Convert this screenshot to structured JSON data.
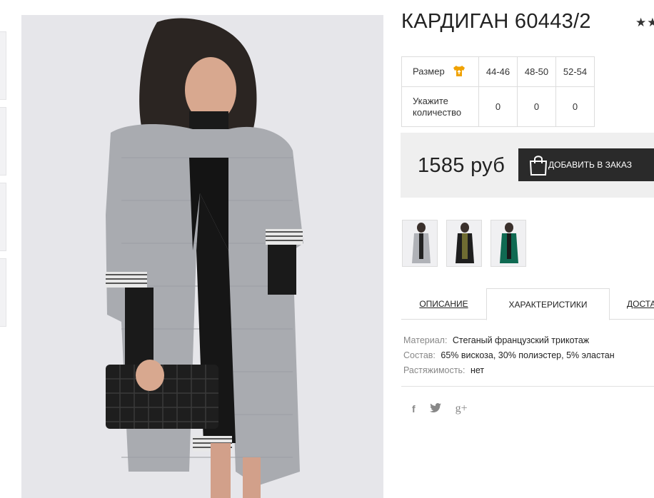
{
  "product": {
    "title": "КАРДИГАН 60443/2",
    "rating_stars": "★★"
  },
  "size_table": {
    "size_label": "Размер",
    "sizes": [
      "44-46",
      "48-50",
      "52-54"
    ],
    "quantity_label_line1": "Укажите",
    "quantity_label_line2": "количество",
    "quantities": [
      "0",
      "0",
      "0"
    ]
  },
  "price": {
    "amount": "1585 руб",
    "add_to_cart_label": "ДОБАВИТЬ В ЗАКАЗ"
  },
  "tabs": [
    {
      "label": "ОПИСАНИЕ"
    },
    {
      "label": "ХАРАКТЕРИСТИКИ"
    },
    {
      "label": "ДОСТАВКА"
    }
  ],
  "characteristics": [
    {
      "key": "Материал:",
      "value": "Стеганый французский трикотаж"
    },
    {
      "key": "Состав:",
      "value": "65% вискоза, 30% полиэстер, 5% эластан"
    },
    {
      "key": "Растяжимость:",
      "value": "нет"
    }
  ],
  "social": {
    "facebook_glyph": "f",
    "google_plus_glyph": "g+"
  },
  "colors": {
    "button_bg": "#2a2a2a",
    "price_box_bg": "#efefef",
    "size_icon": "#f0a202"
  }
}
